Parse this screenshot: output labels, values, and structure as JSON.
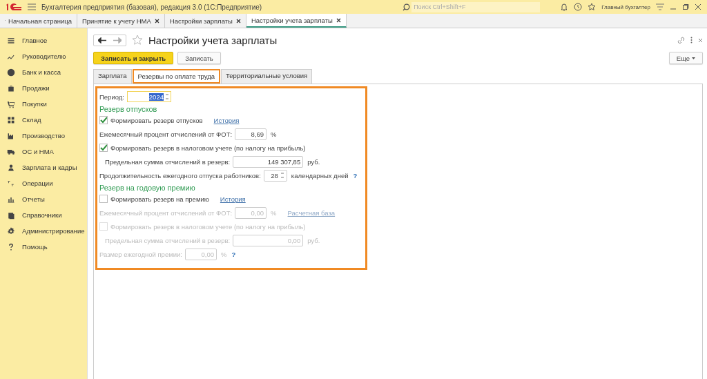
{
  "app_bar": {
    "title": "Бухгалтерия предприятия (базовая), редакция 3.0  (1С:Предприятие)",
    "search": {
      "placeholder": "Поиск Ctrl+Shift+F"
    },
    "user": "Главный бухгалтер"
  },
  "open_tabs": {
    "home": "Начальная страница",
    "tabs": [
      {
        "label": "Принятие к учету НМА",
        "selected": false
      },
      {
        "label": "Настройки зарплаты",
        "selected": false
      },
      {
        "label": "Настройки учета зарплаты",
        "selected": true
      }
    ]
  },
  "sidebar": {
    "items": [
      "Главное",
      "Руководителю",
      "Банк и касса",
      "Продажи",
      "Покупки",
      "Склад",
      "Производство",
      "ОС и НМА",
      "Зарплата и кадры",
      "Операции",
      "Отчеты",
      "Справочники",
      "Администрирование",
      "Помощь"
    ]
  },
  "form": {
    "title": "Настройки учета зарплаты",
    "buttons": [
      {
        "label": "Записать и закрыть",
        "kind": "primary"
      },
      {
        "label": "Записать",
        "kind": "default"
      }
    ],
    "more": "Еще",
    "tabs": [
      {
        "label": "Зарплата",
        "selected": false
      },
      {
        "label": "Резервы по оплате труда",
        "selected": true,
        "highlighted": true
      },
      {
        "label": "Территориальные условия",
        "selected": false
      }
    ],
    "highlighted": true,
    "period": {
      "label": "Период:",
      "value": "2024",
      "focused": true
    },
    "sections": [
      {
        "title": "Резерв отпусков",
        "rows": [
          {
            "kind": "checkbox",
            "label": "Формировать резерв отпусков",
            "checked": true,
            "disabled": false,
            "link": "История"
          },
          {
            "kind": "number",
            "label": "Ежемесячный процент отчислений от ФОТ:",
            "value": "8,69",
            "unit": "%",
            "disabled": false,
            "indent": false
          },
          {
            "kind": "checkbox",
            "label": "Формировать резерв в налоговом учете (по налогу на прибыль)",
            "checked": true,
            "disabled": false
          },
          {
            "kind": "number",
            "label": "Предельная сумма отчислений в резерв:",
            "value": "149 307,85",
            "unit": "руб.",
            "disabled": false,
            "indent": true
          },
          {
            "kind": "spin",
            "label": "Продолжительность ежегодного отпуска работников:",
            "value": "28",
            "unit": "календарных дней",
            "help": "?",
            "disabled": false
          }
        ]
      },
      {
        "title": "Резерв на годовую премию",
        "rows": [
          {
            "kind": "checkbox",
            "label": "Формировать резерв на премию",
            "checked": false,
            "disabled": false,
            "link": "История"
          },
          {
            "kind": "number",
            "label": "Ежемесячный процент отчислений от ФОТ:",
            "value": "0,00",
            "unit": "%",
            "disabled": true,
            "indent": false,
            "link": "Расчетная база"
          },
          {
            "kind": "checkbox",
            "label": "Формировать резерв в налоговом учете (по налогу на прибыль)",
            "checked": false,
            "disabled": true
          },
          {
            "kind": "number",
            "label": "Предельная сумма отчислений в резерв:",
            "value": "0,00",
            "unit": "руб.",
            "disabled": true,
            "indent": true
          },
          {
            "kind": "number",
            "label": "Размер ежегодной премии:",
            "value": "0,00",
            "unit": "%",
            "disabled": true,
            "indent": false,
            "help": "?"
          }
        ]
      }
    ]
  }
}
